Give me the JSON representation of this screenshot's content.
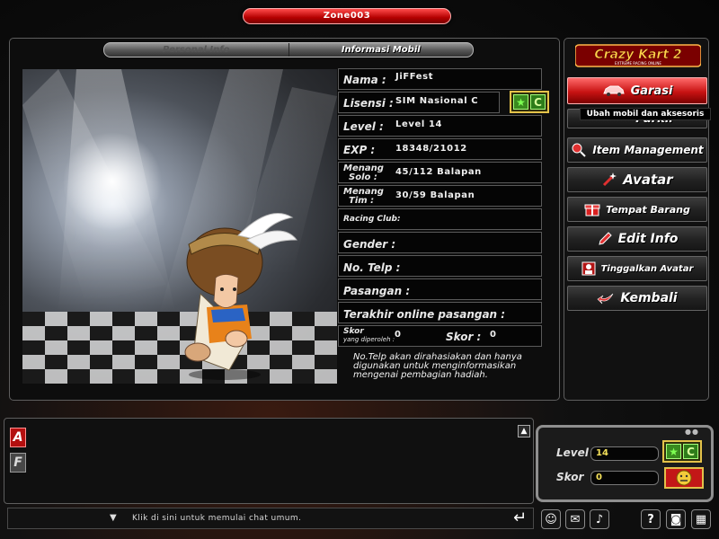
{
  "zone": {
    "title": "Zone003"
  },
  "tabs": {
    "personal": "Personal Info",
    "mobil": "Informasi Mobil"
  },
  "info": {
    "nama_label": "Nama :",
    "nama": "JiFFest",
    "lisensi_label": "Lisensi :",
    "lisensi": "SIM Nasional C",
    "level_label": "Level :",
    "level": "Level 14",
    "exp_label": "EXP :",
    "exp": "18348/21012",
    "solo_label_1": "Menang",
    "solo_label_2": "Solo :",
    "solo": "45/112 Balapan",
    "tim_label_1": "Menang",
    "tim_label_2": "Tim :",
    "tim": "30/59 Balapan",
    "club_label": "Racing Club:",
    "club": "",
    "gender_label": "Gender :",
    "gender": "",
    "telp_label": "No. Telp :",
    "telp": "",
    "pasangan_label": "Pasangan :",
    "pasangan": "",
    "terakhir_label": "Terakhir online pasangan :",
    "terakhir": "",
    "skor_label": "Skor",
    "skor_sub": "yang diperoleh :",
    "skor_diperoleh": "0",
    "skor2_label": "Skor :",
    "skor2": "0",
    "license_grade": "C",
    "note": "No.Telp akan dirahasiakan dan hanya digunakan untuk menginformasikan mengenai pembagian hadiah."
  },
  "logo": {
    "brand": "Crazy Kart 2",
    "tagline": "EXTREME RACING ONLINE"
  },
  "menu": {
    "garasi": "Garasi",
    "tooltip": "Ubah mobil dan aksesoris",
    "parkir": "Parkir",
    "item_management": "Item Management",
    "avatar": "Avatar",
    "tempat_barang": "Tempat Barang",
    "edit_info": "Edit Info",
    "tinggalkan_avatar": "Tinggalkan Avatar",
    "kembali": "Kembali"
  },
  "chat": {
    "tab_a": "A",
    "tab_f": "F",
    "placeholder": "Klik di sini untuk memulai chat umum."
  },
  "status": {
    "level_label": "Level",
    "level_value": "14",
    "skor_label": "Skor",
    "skor_value": "0",
    "grade": "C"
  },
  "colors": {
    "accent_red": "#c81313",
    "badge_gold": "#e4c24a",
    "grade_green": "#3a8a1f"
  },
  "icons": [
    "smiley-icon",
    "mail-icon",
    "speaker-icon",
    "help-icon",
    "camera-icon",
    "grid-icon"
  ]
}
